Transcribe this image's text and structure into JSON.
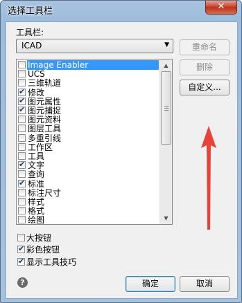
{
  "window": {
    "title": "选择工具栏",
    "close_glyph": "✕"
  },
  "toolbar_label": "工具栏:",
  "menu_group": {
    "selected": "ICAD"
  },
  "buttons": {
    "rename": "重命名",
    "delete": "删除",
    "customize": "自定义...",
    "ok": "确定",
    "cancel": "取消"
  },
  "toolbars": [
    {
      "label": "Image Enabler",
      "checked": false,
      "selected": true
    },
    {
      "label": "UCS",
      "checked": false
    },
    {
      "label": "三维轨道",
      "checked": false
    },
    {
      "label": "修改",
      "checked": true
    },
    {
      "label": "图元属性",
      "checked": true
    },
    {
      "label": "图元捕捉",
      "checked": true
    },
    {
      "label": "图元资料",
      "checked": false
    },
    {
      "label": "图层工具",
      "checked": false
    },
    {
      "label": "多重引线",
      "checked": false
    },
    {
      "label": "工作区",
      "checked": false
    },
    {
      "label": "工具",
      "checked": false
    },
    {
      "label": "文字",
      "checked": true
    },
    {
      "label": "查询",
      "checked": false
    },
    {
      "label": "标准",
      "checked": true
    },
    {
      "label": "标注尺寸",
      "checked": false
    },
    {
      "label": "样式",
      "checked": false
    },
    {
      "label": "格式",
      "checked": false
    },
    {
      "label": "绘图",
      "checked": false
    }
  ],
  "options": {
    "large_buttons": {
      "label": "大按钮",
      "checked": false
    },
    "color_buttons": {
      "label": "彩色按钮",
      "checked": true
    },
    "show_tooltips": {
      "label": "显示工具技巧",
      "checked": true
    }
  },
  "help_glyph": "?",
  "check_glyph": "✔",
  "colors": {
    "selection": "#3399ff",
    "annotation_arrow": "#e8433a"
  }
}
